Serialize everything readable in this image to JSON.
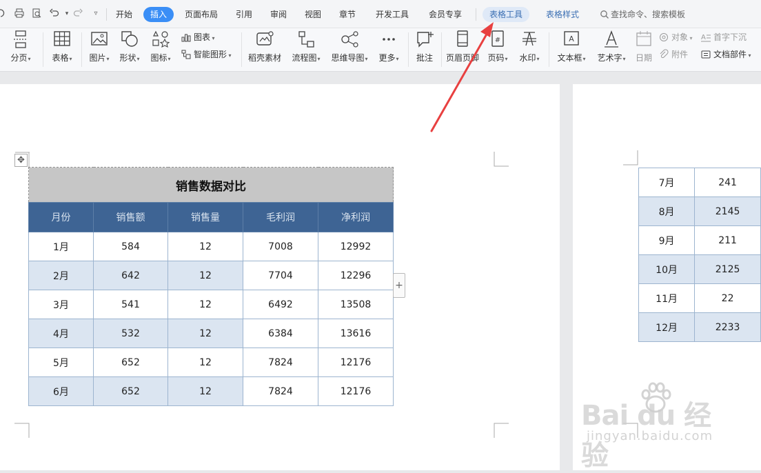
{
  "menubar": {
    "tabs": [
      {
        "label": "开始"
      },
      {
        "label": "插入"
      },
      {
        "label": "页面布局"
      },
      {
        "label": "引用"
      },
      {
        "label": "审阅"
      },
      {
        "label": "视图"
      },
      {
        "label": "章节"
      },
      {
        "label": "开发工具"
      },
      {
        "label": "会员专享"
      }
    ],
    "active_tab": "插入",
    "context_tabs": [
      {
        "label": "表格工具"
      },
      {
        "label": "表格样式"
      }
    ],
    "search_placeholder": "查找命令、搜索模板"
  },
  "ribbon": {
    "page_break": "分页",
    "table": "表格",
    "picture": "图片",
    "shape": "形状",
    "icon": "图标",
    "chart": "图表",
    "smart_graphic": "智能图形",
    "docer_material": "稻壳素材",
    "flowchart": "流程图",
    "mindmap": "思维导图",
    "more": "更多",
    "comment": "批注",
    "header_footer": "页眉页脚",
    "page_number": "页码",
    "watermark": "水印",
    "textbox": "文本框",
    "wordart": "艺术字",
    "date": "日期",
    "object": "对象",
    "attachment": "附件",
    "drop_cap": "首字下沉",
    "doc_parts": "文档部件"
  },
  "table1": {
    "title": "销售数据对比",
    "headers": [
      "月份",
      "销售额",
      "销售量",
      "毛利润",
      "净利润"
    ],
    "rows": [
      [
        "1月",
        "584",
        "12",
        "7008",
        "12992"
      ],
      [
        "2月",
        "642",
        "12",
        "7704",
        "12296"
      ],
      [
        "3月",
        "541",
        "12",
        "6492",
        "13508"
      ],
      [
        "4月",
        "532",
        "12",
        "6384",
        "13616"
      ],
      [
        "5月",
        "652",
        "12",
        "7824",
        "12176"
      ],
      [
        "6月",
        "652",
        "12",
        "7824",
        "12176"
      ]
    ]
  },
  "table2": {
    "rows": [
      [
        "7月",
        "241"
      ],
      [
        "8月",
        "2145"
      ],
      [
        "9月",
        "211"
      ],
      [
        "10月",
        "2125"
      ],
      [
        "11月",
        "22"
      ],
      [
        "12月",
        "2233"
      ]
    ]
  },
  "watermark": {
    "main": "Bai du 经验",
    "sub": "jingyan.baidu.com"
  },
  "colors": {
    "accent": "#3a8ef6",
    "table_header": "#3e6494",
    "table_band": "#dbe5f1",
    "arrow": "#e84040"
  }
}
